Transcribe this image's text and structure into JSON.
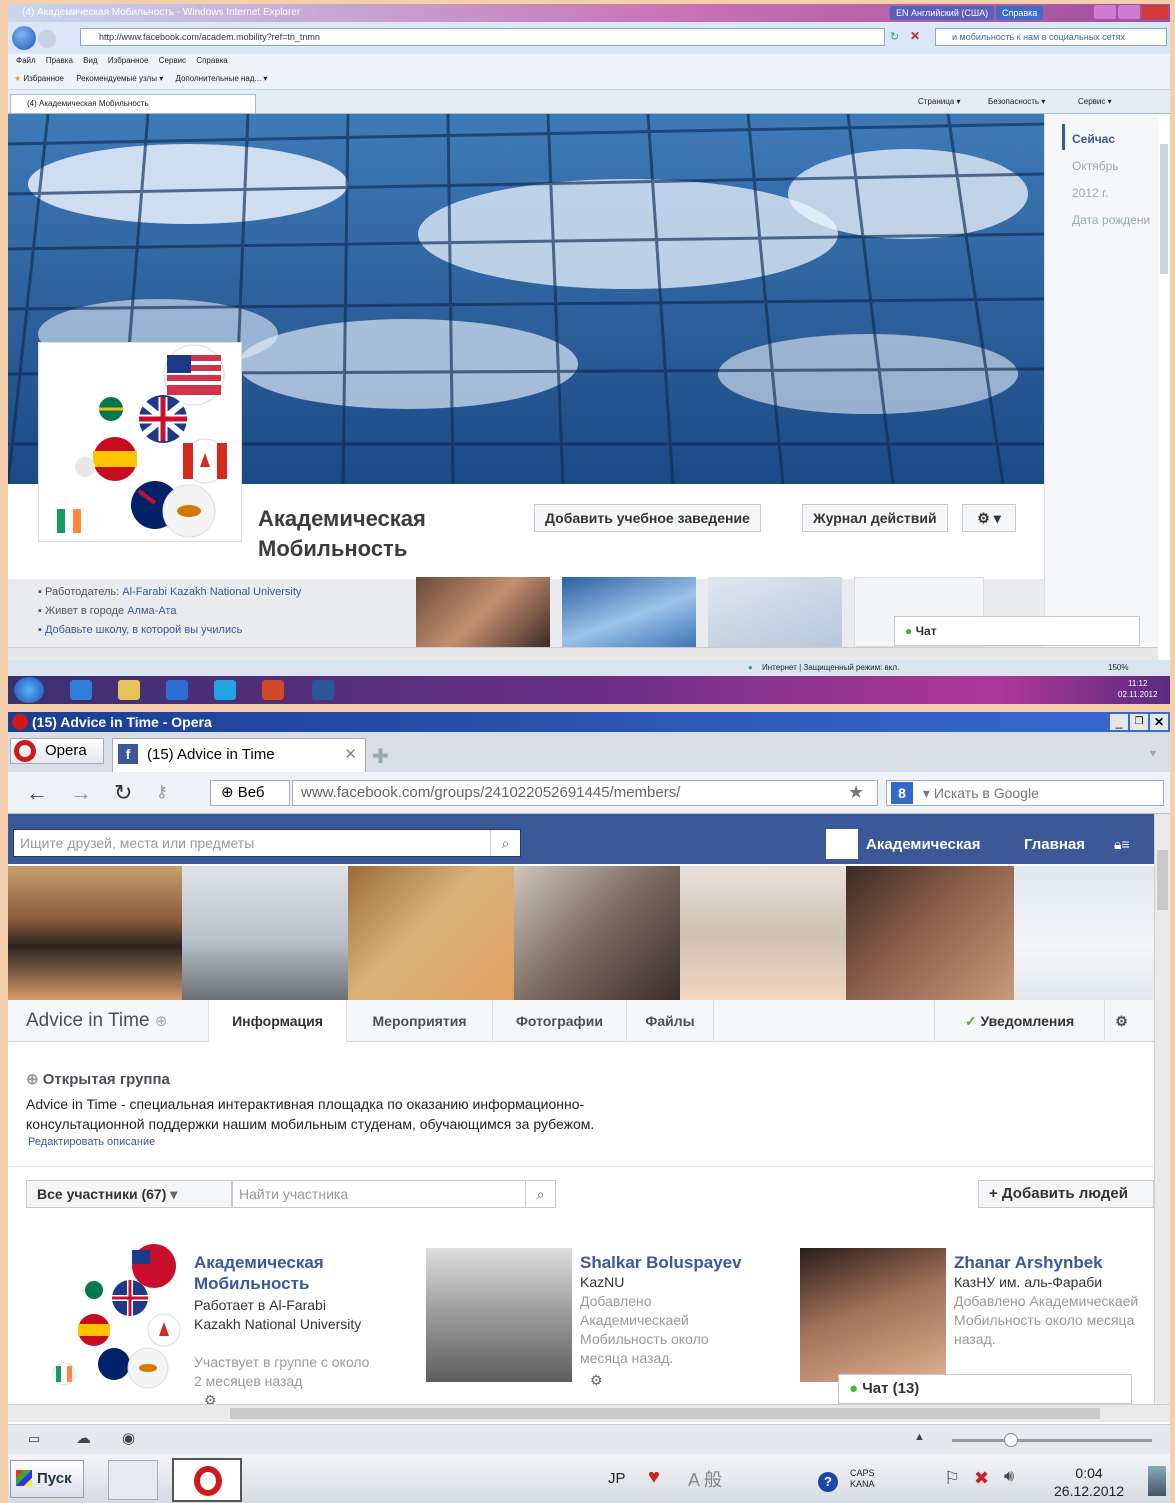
{
  "ie": {
    "title": "(4) Академическая Мобильность - Windows Internet Explorer",
    "lang_button": "EN Английский (США)",
    "help_button": "Справка",
    "url": "http://www.facebook.com/academ.mobility?ref=tn_tnmn",
    "search_text": "и мобильность к нам в социальных сетях",
    "menu": [
      "Файл",
      "Правка",
      "Вид",
      "Избранное",
      "Сервис",
      "Справка"
    ],
    "favorites_label": "Избранное",
    "fav_links": [
      "Рекомендуемые узлы ▾",
      "Дополнительные над... ▾"
    ],
    "tab_title": "(4) Академическая Мобильность",
    "cmd_bar": [
      "Страница ▾",
      "Безопасность ▾",
      "Сервис ▾"
    ],
    "timeline": [
      "Сейчас",
      "Октябрь",
      "2012 г.",
      "Дата рождени"
    ],
    "page_name": "Академическая Мобильность",
    "add_school_button": "Добавить учебное заведение",
    "activity_log_button": "Журнал действий",
    "info": {
      "employer_label": "Работодатель:",
      "employer": "Al-Farabi Kazakh National University",
      "lives_label": "Живет в городе",
      "city": "Алма-Ата",
      "add_school": "Добавьте школу, в которой вы учились"
    },
    "chat": "Чат",
    "status_zone": "Интернет | Защищенный режим: вкл.",
    "zoom": "150%",
    "clock_time": "11:12",
    "clock_date": "02.11.2012"
  },
  "opera": {
    "title": "(15) Advice in Time - Opera",
    "menu_button": "Opera",
    "tab_title": "(15) Advice in Time",
    "web_label": "Веб",
    "url": "www.facebook.com/groups/241022052691445/members/",
    "search_placeholder": "Искать в Google",
    "fb": {
      "search_placeholder": "Ищите друзей, места или предметы",
      "profile_name": "Академическая",
      "home": "Главная",
      "group_name": "Advice in Time",
      "tabs": [
        "Информация",
        "Мероприятия",
        "Фотографии",
        "Файлы"
      ],
      "notifications": "Уведомления",
      "open_group": "Открытая группа",
      "description": "Advice in Time - специальная интерактивная площадка по оказанию информационно-консультационной поддержки нашим мобильным студенам, обучающимся за рубежом.",
      "edit_description": "Редактировать описание",
      "all_members": "Все участники (67)",
      "find_member_placeholder": "Найти участника",
      "add_people": "+ Добавить людей",
      "chat": "Чат (13)",
      "members": [
        {
          "name": "Академическая Мобильность",
          "line1": "Работает в Al-Farabi Kazakh National University",
          "grey": "Участвует в группе с около 2 месяцев назад"
        },
        {
          "name": "Shalkar Boluspayev",
          "line1": "KazNU",
          "grey": "Добавлено Академическаей Мобильность около месяца назад."
        },
        {
          "name": "Zhanar Arshynbek",
          "line1": "КазНУ им. аль-Фараби",
          "grey": "Добавлено Академическаей Мобильность около месяца назад."
        }
      ]
    },
    "taskbar": {
      "start": "Пуск",
      "lang": "JP",
      "caps": "CAPS",
      "kana": "KANA",
      "time": "0:04",
      "date": "26.12.2012"
    }
  },
  "colors": {
    "fb_blue": "#3b5998",
    "ie_title": "#c86fb2",
    "opera_title": "#1c3d93"
  }
}
